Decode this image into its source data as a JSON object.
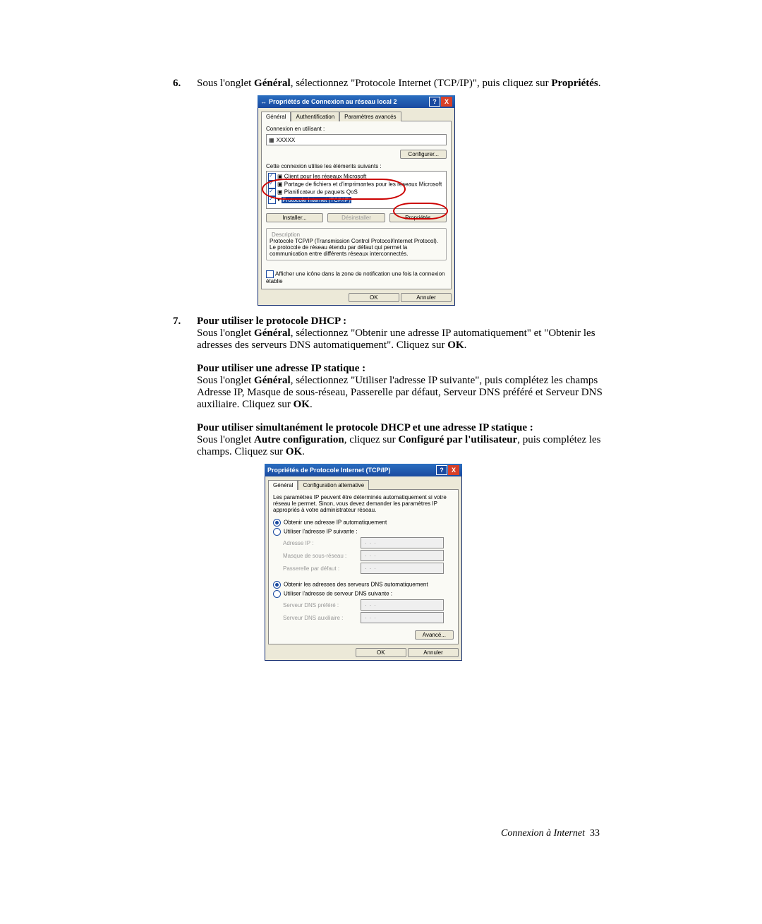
{
  "step6": {
    "num": "6.",
    "text_a": "Sous l'onglet ",
    "bold_a": "Général",
    "text_b": ", sélectionnez \"Protocole Internet (TCP/IP)\", puis cliquez sur ",
    "bold_b": "Propriétés",
    "text_c": "."
  },
  "dialog1": {
    "title": "Propriétés de Connexion au réseau local 2",
    "help_icon": "?",
    "close_icon": "X",
    "tabs": [
      "Général",
      "Authentification",
      "Paramètres avancés"
    ],
    "connect_using_label": "Connexion en utilisant :",
    "adapter": "XXXXX",
    "configure_btn": "Configurer...",
    "uses_label": "Cette connexion utilise les éléments suivants :",
    "items": [
      {
        "checked": true,
        "label": "Client pour les réseaux Microsoft"
      },
      {
        "checked": true,
        "label": "Partage de fichiers et d'imprimantes pour les réseaux Microsoft"
      },
      {
        "checked": true,
        "label": "Planificateur de paquets QoS"
      },
      {
        "checked": true,
        "label": "Protocole Internet (TCP/IP)",
        "selected": true
      }
    ],
    "install_btn": "Installer...",
    "uninstall_btn": "Désinstaller",
    "properties_btn": "Propriétés",
    "desc_title": "Description",
    "desc_text": "Protocole TCP/IP (Transmission Control Protocol/Internet Protocol). Le protocole de réseau étendu par défaut qui permet la communication entre différents réseaux interconnectés.",
    "notify_chk": "Afficher une icône dans la zone de notification une fois la connexion établie",
    "ok": "OK",
    "cancel": "Annuler"
  },
  "step7": {
    "num": "7.",
    "h1": "Pour utiliser le protocole DHCP :",
    "p1_a": "Sous l'onglet ",
    "p1_bold1": "Général",
    "p1_b": ", sélectionnez \"Obtenir une adresse IP automatiquement\" et \"Obtenir les adresses des serveurs DNS automatiquement\". Cliquez sur ",
    "p1_bold2": "OK",
    "p1_c": ".",
    "h2": "Pour utiliser une adresse IP statique :",
    "p2_a": "Sous l'onglet ",
    "p2_bold1": "Général",
    "p2_b": ", sélectionnez \"Utiliser l'adresse IP suivante\", puis complétez les champs Adresse IP, Masque de sous-réseau, Passerelle par défaut, Serveur DNS préféré et Serveur DNS auxiliaire. Cliquez sur ",
    "p2_bold2": "OK",
    "p2_c": ".",
    "h3": "Pour utiliser simultanément le protocole DHCP et une adresse IP statique :",
    "p3_a": "Sous l'onglet ",
    "p3_bold1": "Autre configuration",
    "p3_b": ", cliquez sur ",
    "p3_bold2": "Configuré par l'utilisateur",
    "p3_c": ", puis complétez les champs. Cliquez sur ",
    "p3_bold3": "OK",
    "p3_d": "."
  },
  "dialog2": {
    "title": "Propriétés de Protocole Internet (TCP/IP)",
    "help_icon": "?",
    "close_icon": "X",
    "tabs": [
      "Général",
      "Configuration alternative"
    ],
    "intro": "Les paramètres IP peuvent être déterminés automatiquement si votre réseau le permet. Sinon, vous devez demander les paramètres IP appropriés à votre administrateur réseau.",
    "r_ip_auto": "Obtenir une adresse IP automatiquement",
    "r_ip_man": "Utiliser l'adresse IP suivante :",
    "f_ip": "Adresse IP :",
    "f_mask": "Masque de sous-réseau :",
    "f_gw": "Passerelle par défaut :",
    "r_dns_auto": "Obtenir les adresses des serveurs DNS automatiquement",
    "r_dns_man": "Utiliser l'adresse de serveur DNS suivante :",
    "f_dns1": "Serveur DNS préféré :",
    "f_dns2": "Serveur DNS auxiliaire :",
    "advanced_btn": "Avancé...",
    "ok": "OK",
    "cancel": "Annuler"
  },
  "footer": {
    "title": "Connexion à Internet",
    "page": "33"
  }
}
